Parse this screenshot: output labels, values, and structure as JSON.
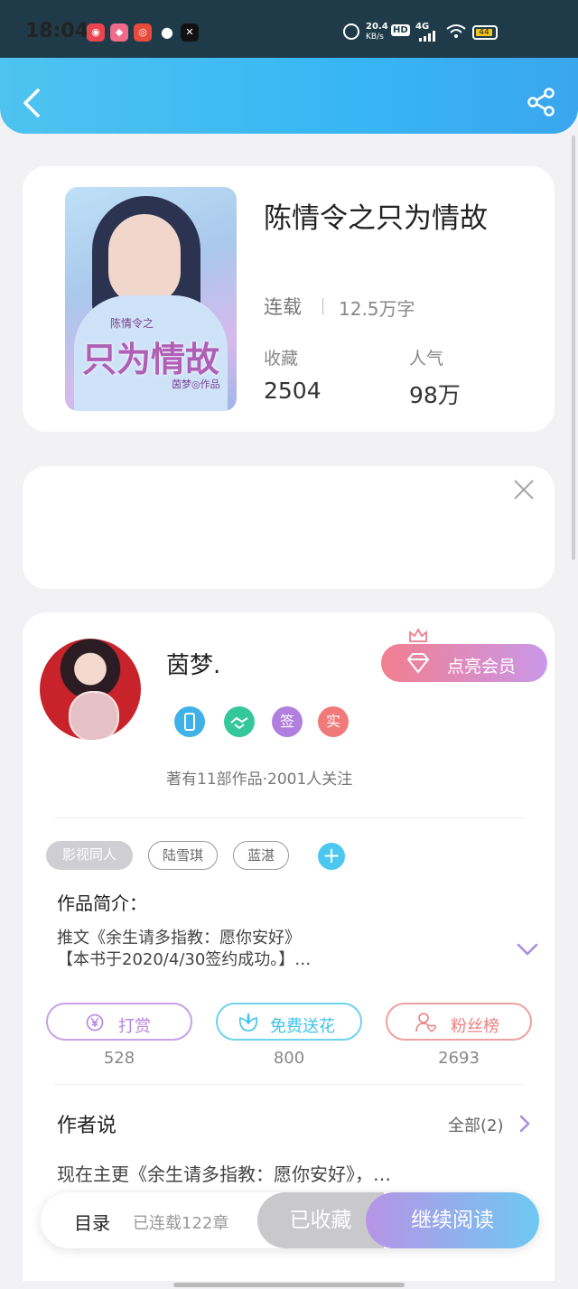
{
  "status_bar": {
    "time": "18:04",
    "net_speed_value": "20.4",
    "net_speed_unit": "KB/s",
    "hd": "HD",
    "network": "4G",
    "battery": "44"
  },
  "book": {
    "title": "陈情令之只为情故",
    "status": "连载",
    "word_count": "12.5万字",
    "favorites_label": "收藏",
    "favorites_value": "2504",
    "popularity_label": "人气",
    "popularity_value": "98万",
    "cover": {
      "subtitle": "陈情令之",
      "title": "只为情故",
      "author": "茵梦◎作品"
    }
  },
  "author": {
    "name": "茵梦.",
    "vip_button": "点亮会员",
    "badges": [
      {
        "icon": "phone-badge-icon",
        "label": "",
        "color": "#3fb1e8"
      },
      {
        "icon": "handshake-badge-icon",
        "label": "",
        "color": "#34c79a"
      },
      {
        "icon": "signed-badge-icon",
        "label": "签",
        "color": "#b07fe0"
      },
      {
        "icon": "verified-badge-icon",
        "label": "实",
        "color": "#f07a7a"
      }
    ],
    "meta": "著有11部作品·2001人关注"
  },
  "tags": [
    "影视同人",
    "陆雪琪",
    "蓝湛",
    "+"
  ],
  "intro": {
    "heading": "作品简介：",
    "line1": "推文《余生请多指教：愿你安好》",
    "line2": "【本书于2020/4/30签约成功。】…"
  },
  "actions": [
    {
      "label": "打赏",
      "icon": "yen-icon",
      "count": "528",
      "color": "#b584e0"
    },
    {
      "label": "免费送花",
      "icon": "flower-icon",
      "count": "800",
      "color": "#3ec3e8"
    },
    {
      "label": "粉丝榜",
      "icon": "fan-user-icon",
      "count": "2693",
      "color": "#ec7f7f"
    }
  ],
  "author_says": {
    "heading": "作者说",
    "all": "全部(2)",
    "text": "现在主更《余生请多指教：愿你安好》，…"
  },
  "bottom_bar": {
    "toc": "目录",
    "chapters": "已连载122章",
    "saved": "已收藏",
    "continue": "继续阅读"
  },
  "colors": {
    "header_gradient_start": "#4ec3f0",
    "header_gradient_end": "#3aa6ee",
    "vip_gradient_start": "#f27e8f",
    "vip_gradient_end": "#c998ea",
    "read_gradient_start": "#b794e6",
    "read_gradient_end": "#6ec8f2"
  }
}
